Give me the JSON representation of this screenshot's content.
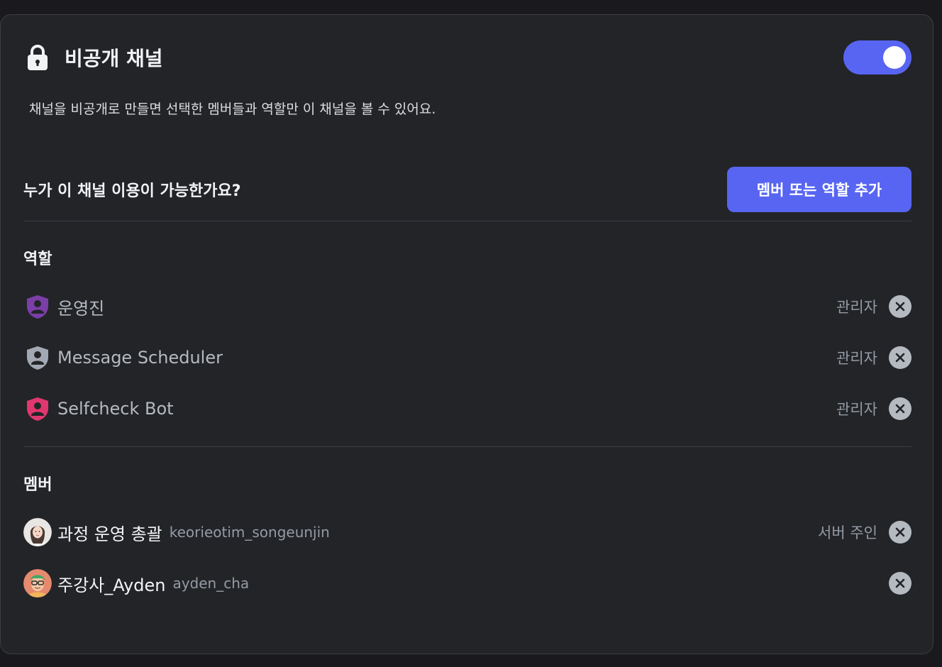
{
  "header": {
    "title": "비공개 채널",
    "lock_icon": "lock-icon",
    "toggle_on": true,
    "accent_color": "#5865f2"
  },
  "description": "채널을 비공개로 만들면 선택한 멤버들과 역할만 이 채널을 볼 수 있어요.",
  "access": {
    "question": "누가 이 채널 이용이 가능한가요?",
    "add_button_label": "멤버 또는 역할 추가"
  },
  "roles_section": {
    "label": "역할",
    "items": [
      {
        "name": "운영진",
        "tag": "관리자",
        "icon": "role-shield-icon",
        "color": "#7b3fa8"
      },
      {
        "name": "Message Scheduler",
        "tag": "관리자",
        "icon": "role-shield-icon",
        "color": "#a3a9b3"
      },
      {
        "name": "Selfcheck Bot",
        "tag": "관리자",
        "icon": "role-shield-icon",
        "color": "#e1376f"
      }
    ]
  },
  "members_section": {
    "label": "멤버",
    "items": [
      {
        "display_name": "과정 운영 총괄",
        "username": "keorieotim_songeunjin",
        "tag": "서버 주인",
        "avatar": "avatar-woman"
      },
      {
        "display_name": "주강사_Ayden",
        "username": "ayden_cha",
        "tag": "",
        "avatar": "avatar-man-glasses"
      }
    ]
  }
}
